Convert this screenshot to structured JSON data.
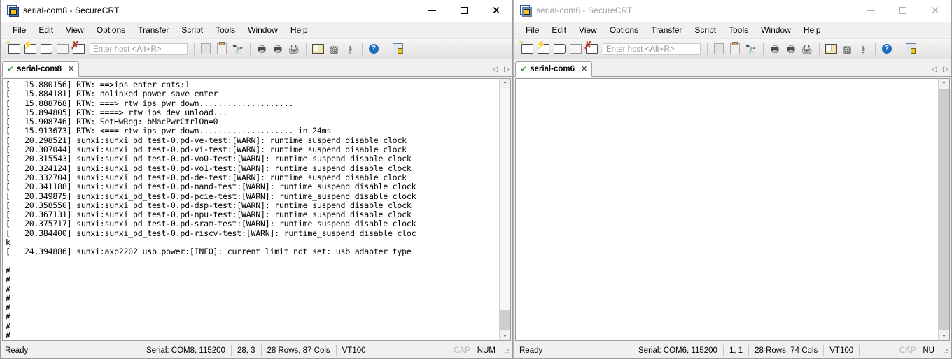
{
  "windows": [
    {
      "id": "left",
      "title": "serial-com8 - SecureCRT",
      "active": true,
      "menu": [
        "File",
        "Edit",
        "View",
        "Options",
        "Transfer",
        "Script",
        "Tools",
        "Window",
        "Help"
      ],
      "toolbar": {
        "host_placeholder": "Enter host <Alt+R>",
        "icons": [
          "connect-icon",
          "quick-connect-icon",
          "connect-in-tab-icon",
          "reconnect-icon",
          "disconnect-icon",
          "copy-icon",
          "paste-icon",
          "find-icon",
          "print-screen-icon",
          "print-selection-icon",
          "print-icon",
          "session-options-icon",
          "global-options-icon",
          "key-icon",
          "help-icon",
          "lock-icon"
        ]
      },
      "tab": {
        "label": "serial-com8",
        "status_icon": "connected-check-icon",
        "close_icon": "close-icon",
        "scroll_left_icon": "chevron-left-icon",
        "scroll_right_icon": "chevron-right-icon"
      },
      "terminal": {
        "lines": [
          "[   15.880156] RTW: ==>ips_enter cnts:1",
          "[   15.884181] RTW: nolinked power save enter",
          "[   15.888768] RTW: ===> rtw_ips_pwr_down....................",
          "[   15.894805] RTW: ====> rtw_ips_dev_unload...",
          "[   15.908746] RTW: SetHwReg: bMacPwrCtrlOn=0",
          "[   15.913673] RTW: <=== rtw_ips_pwr_down.................... in 24ms",
          "[   20.298521] sunxi:sunxi_pd_test-0.pd-ve-test:[WARN]: runtime_suspend disable clock",
          "[   20.307044] sunxi:sunxi_pd_test-0.pd-vi-test:[WARN]: runtime_suspend disable clock",
          "[   20.315543] sunxi:sunxi_pd_test-0.pd-vo0-test:[WARN]: runtime_suspend disable clock",
          "[   20.324124] sunxi:sunxi_pd_test-0.pd-vo1-test:[WARN]: runtime_suspend disable clock",
          "[   20.332704] sunxi:sunxi_pd_test-0.pd-de-test:[WARN]: runtime_suspend disable clock",
          "[   20.341188] sunxi:sunxi_pd_test-0.pd-nand-test:[WARN]: runtime_suspend disable clock",
          "[   20.349875] sunxi:sunxi_pd_test-0.pd-pcie-test:[WARN]: runtime_suspend disable clock",
          "[   20.358550] sunxi:sunxi_pd_test-0.pd-dsp-test:[WARN]: runtime_suspend disable clock",
          "[   20.367131] sunxi:sunxi_pd_test-0.pd-npu-test:[WARN]: runtime_suspend disable clock",
          "[   20.375717] sunxi:sunxi_pd_test-0.pd-sram-test:[WARN]: runtime_suspend disable clock",
          "[   20.384400] sunxi:sunxi_pd_test-0.pd-riscv-test:[WARN]: runtime_suspend disable cloc",
          "k",
          "[   24.394886] sunxi:axp2202_usb_power:[INFO]: current limit not set: usb adapter type",
          "",
          "#",
          "#",
          "#",
          "#",
          "#",
          "#",
          "#",
          "#"
        ]
      },
      "statusbar": {
        "ready": "Ready",
        "serial": "Serial: COM8, 115200",
        "cursor": "28,  3",
        "size": "28 Rows, 87 Cols",
        "emulation": "VT100",
        "cap": "CAP",
        "num": "NUM"
      }
    },
    {
      "id": "right",
      "title": "serial-com6 - SecureCRT",
      "active": false,
      "menu": [
        "File",
        "Edit",
        "View",
        "Options",
        "Transfer",
        "Script",
        "Tools",
        "Window",
        "Help"
      ],
      "toolbar": {
        "host_placeholder": "Enter host <Alt+R>",
        "icons": [
          "connect-icon",
          "quick-connect-icon",
          "connect-in-tab-icon",
          "reconnect-icon",
          "disconnect-icon",
          "copy-icon",
          "paste-icon",
          "find-icon",
          "print-screen-icon",
          "print-selection-icon",
          "print-icon",
          "session-options-icon",
          "global-options-icon",
          "key-icon",
          "help-icon",
          "lock-icon"
        ]
      },
      "tab": {
        "label": "serial-com6",
        "status_icon": "connected-check-icon",
        "close_icon": "close-icon",
        "scroll_left_icon": "chevron-left-icon",
        "scroll_right_icon": "chevron-right-icon"
      },
      "terminal": {
        "lines": [
          ""
        ]
      },
      "statusbar": {
        "ready": "Ready",
        "serial": "Serial: COM6, 115200",
        "cursor": "1,  1",
        "size": "28 Rows, 74 Cols",
        "emulation": "VT100",
        "cap": "CAP",
        "num": "NU"
      }
    }
  ],
  "window_controls": {
    "minimize": "minimize-button",
    "maximize": "maximize-button",
    "close": "close-button",
    "close_glyph": "✕"
  },
  "colors": {
    "accent": "#2b5797",
    "connected": "#3aa03a",
    "disconnect": "#c0392b",
    "terminal_bg": "#ffffff",
    "chrome_bg": "#f0f0f0"
  }
}
